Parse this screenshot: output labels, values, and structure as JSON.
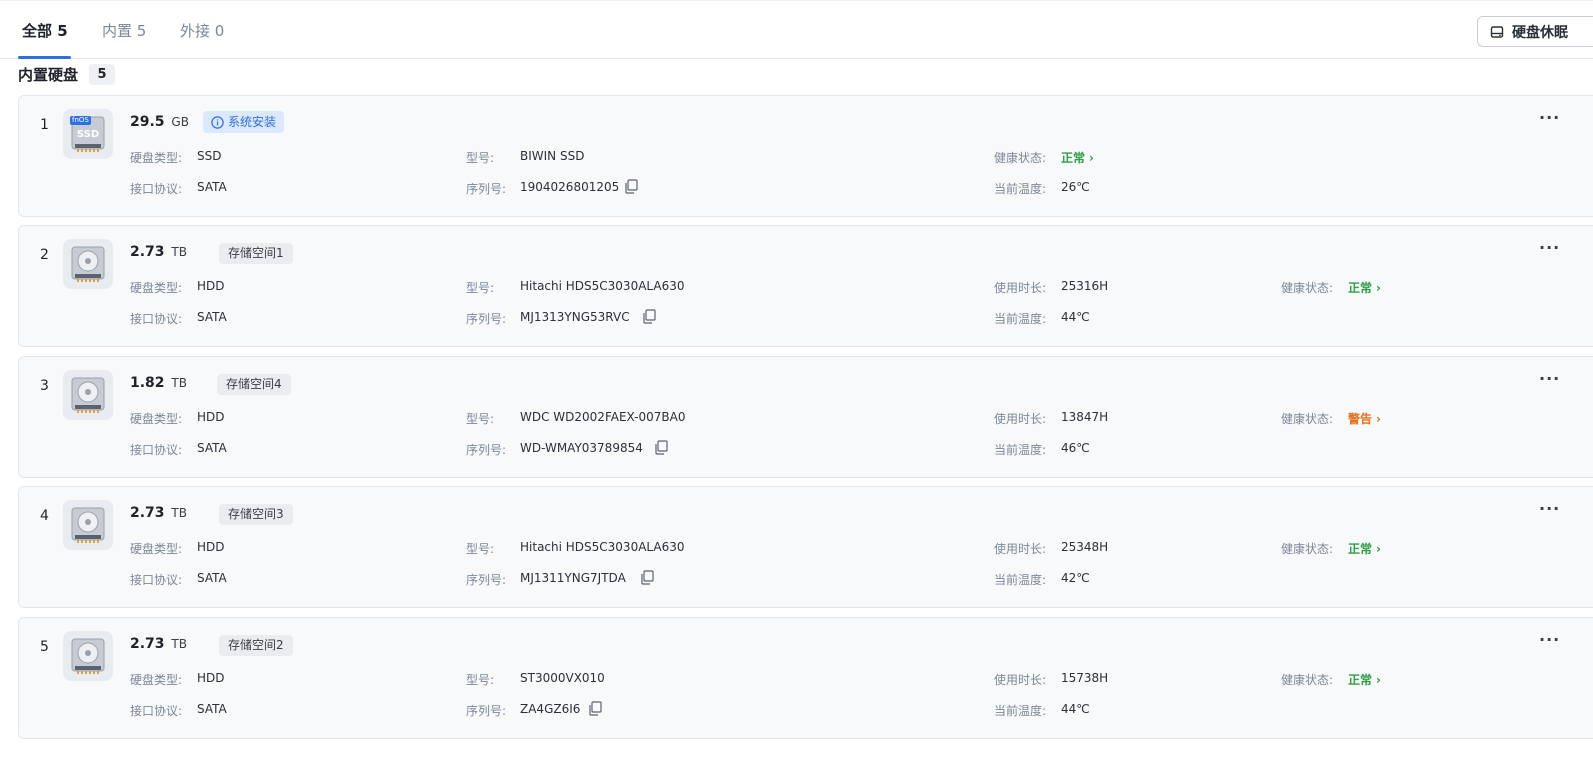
{
  "tabs": [
    {
      "label": "全部",
      "count": "5"
    },
    {
      "label": "内置",
      "count": "5"
    },
    {
      "label": "外接",
      "count": "0"
    }
  ],
  "toolbar": {
    "sleep_label": "硬盘休眠"
  },
  "section": {
    "title": "内置硬盘",
    "count": "5"
  },
  "labels": {
    "type": "硬盘类型:",
    "iface": "接口协议:",
    "model": "型号:",
    "serial": "序列号:",
    "hours": "使用时长:",
    "health": "健康状态:",
    "temp": "当前温度:"
  },
  "disks": [
    {
      "index": "1",
      "capacity": "29.5",
      "unit": "GB",
      "tag": "系统安装",
      "icon_badge": "fnOS",
      "icon_text": "SSD",
      "type": "SSD",
      "iface": "SATA",
      "model": "BIWIN SSD",
      "serial": "1904026801205",
      "hours": "",
      "health": "正常",
      "temp": "26℃"
    },
    {
      "index": "2",
      "capacity": "2.73",
      "unit": "TB",
      "tag": "存储空间1",
      "type": "HDD",
      "iface": "SATA",
      "model": "Hitachi HDS5C3030ALA630",
      "serial": "MJ1313YNG53RVC",
      "hours": "25316H",
      "health": "正常",
      "temp": "44℃"
    },
    {
      "index": "3",
      "capacity": "1.82",
      "unit": "TB",
      "tag": "存储空间4",
      "type": "HDD",
      "iface": "SATA",
      "model": "WDC WD2002FAEX-007BA0",
      "serial": "WD-WMAY03789854",
      "hours": "13847H",
      "health": "警告",
      "temp": "46℃"
    },
    {
      "index": "4",
      "capacity": "2.73",
      "unit": "TB",
      "tag": "存储空间3",
      "type": "HDD",
      "iface": "SATA",
      "model": "Hitachi HDS5C3030ALA630",
      "serial": "MJ1311YNG7JTDA",
      "hours": "25348H",
      "health": "正常",
      "temp": "42℃"
    },
    {
      "index": "5",
      "capacity": "2.73",
      "unit": "TB",
      "tag": "存储空间2",
      "type": "HDD",
      "iface": "SATA",
      "model": "ST3000VX010",
      "serial": "ZA4GZ6I6",
      "hours": "15738H",
      "health": "正常",
      "temp": "44℃"
    }
  ],
  "more_label": "···",
  "chevron": "›",
  "colors": {
    "accent": "#2f6fe4",
    "ok": "#2f9e44",
    "warn": "#e5711d"
  },
  "icons": {
    "disk": "hard-disk-icon",
    "copy": "copy-icon",
    "info": "info-icon",
    "more": "more-icon"
  }
}
